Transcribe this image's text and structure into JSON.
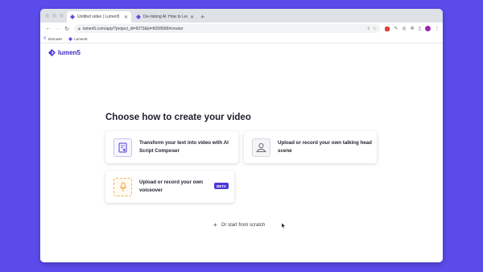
{
  "browser": {
    "tabs": [
      {
        "label": "Untitled video | Lumen5",
        "active": true
      },
      {
        "label": "De-risking AI: How to Leverage...",
        "active": false
      }
    ],
    "new_tab_icon": "plus-icon",
    "url": "lumen5.com/app/?project_id=6073&id=8268668#creator",
    "bookmarks": [
      {
        "label": "Zencastr",
        "icon": "pin-icon"
      },
      {
        "label": "Lumen5",
        "icon": "lumen5-icon"
      }
    ]
  },
  "brand": {
    "name": "lumen5",
    "color": "#3b2dbd"
  },
  "main": {
    "heading": "Choose how to create your video",
    "options": [
      {
        "label": "Transform your text into video with AI Script Composer",
        "icon": "ai-script-icon"
      },
      {
        "label": "Upload or record your own talking head scene",
        "icon": "person-icon"
      },
      {
        "label": "Upload or record your own voiceover",
        "icon": "microphone-icon",
        "badge": "BETA"
      }
    ],
    "scratch_label": "Or start from scratch"
  },
  "colors": {
    "background": "#5b4bea",
    "accent": "#4b3ad8"
  }
}
